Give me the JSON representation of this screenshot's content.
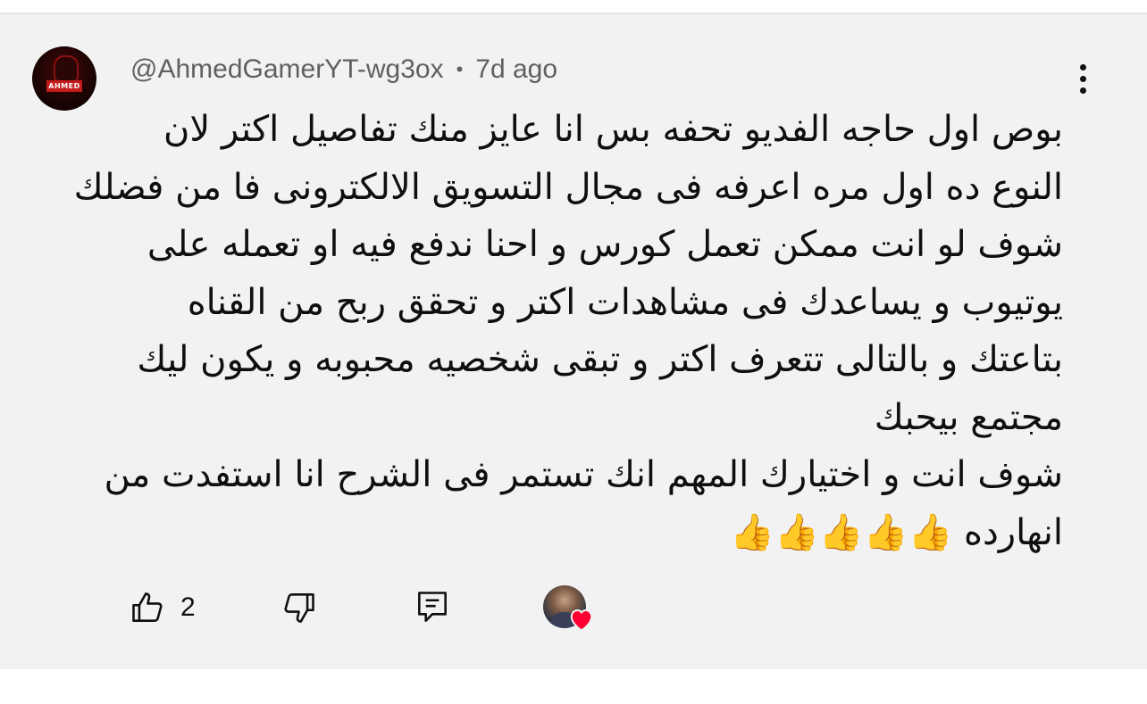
{
  "comment": {
    "author": "@AhmedGamerYT-wg3ox",
    "separator": "•",
    "timestamp": "7d ago",
    "avatar_badge": "AHMED",
    "body_lines": [
      "بوص اول حاجه الفديو تحفه بس انا عايز منك تفاصيل اكتر لان",
      "النوع ده اول مره اعرفه فى مجال التسويق الالكترونى فا من فضلك",
      "شوف لو انت ممكن تعمل كورس و احنا ندفع فيه او تعمله على",
      "يوتيوب و يساعدك فى مشاهدات اكتر و تحقق ربح من القناه",
      "بتاعتك و بالتالى تتعرف اكتر و تبقى شخصيه محبوبه و يكون ليك",
      "مجتمع بيحبك",
      "شوف انت و اختيارك المهم انك تستمر فى الشرح انا استفدت من",
      "انهارده 👍👍👍👍👍"
    ],
    "like_count": "2"
  },
  "icons": {
    "like": "thumbs-up-icon",
    "dislike": "thumbs-down-icon",
    "reply": "reply-icon",
    "menu": "more-vert-icon",
    "heart": "heart-icon"
  },
  "colors": {
    "card_background": "#f2f2f2",
    "meta_text": "#606060",
    "heart": "#ff0033"
  }
}
